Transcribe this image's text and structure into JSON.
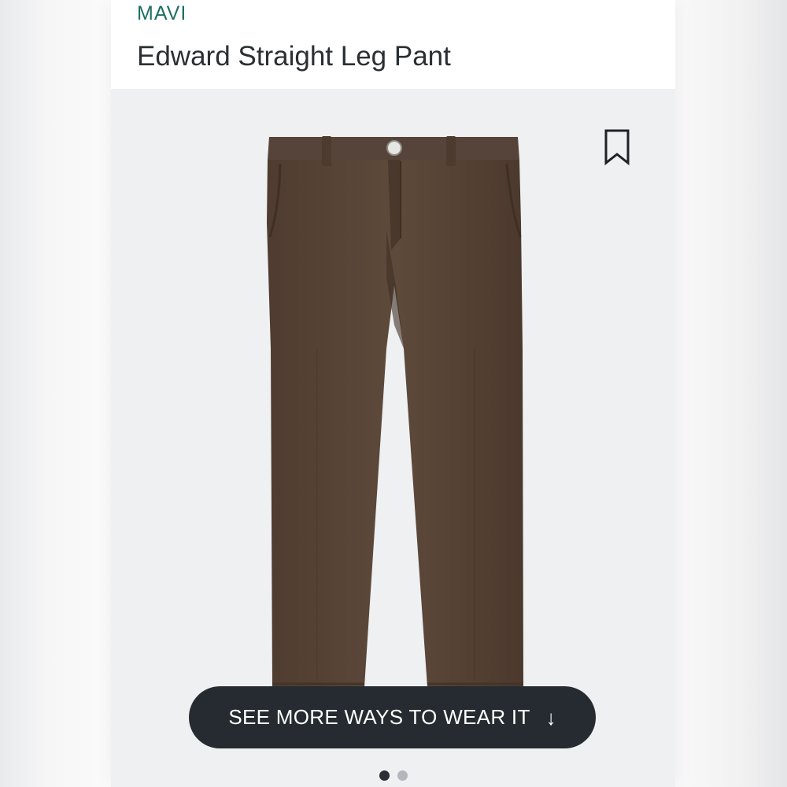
{
  "product": {
    "brand": "MAVI",
    "title": "Edward Straight Leg Pant",
    "image_alt": "Brown straight leg pant"
  },
  "actions": {
    "bookmark_icon": "bookmark-icon",
    "see_more_label": "SEE MORE WAYS TO WEAR IT",
    "see_more_icon": "arrow-down-icon",
    "see_more_arrow": "↓"
  },
  "carousel": {
    "total_images": 2,
    "active_index": 0
  },
  "colors": {
    "brand_text": "#1e6e63",
    "title_text": "#2a2f33",
    "pant_color": "#5a4537",
    "cta_background": "#252b30",
    "cta_text": "#ffffff",
    "dot_active": "#2a2f35",
    "dot_inactive": "#b3b7bb"
  }
}
